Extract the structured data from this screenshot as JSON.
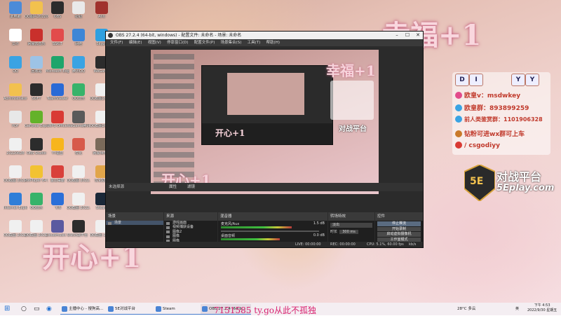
{
  "desktop": {
    "icons": [
      {
        "label": "此电脑",
        "color": "#4b8bd8"
      },
      {
        "label": "QQ图片20220...",
        "color": "#f2c14e"
      },
      {
        "label": "OBS",
        "color": "#2c2c2c"
      },
      {
        "label": "扭钮",
        "color": "#e9e9e9"
      },
      {
        "label": "Anti",
        "color": "#a0322d"
      },
      {
        "label": "文件",
        "color": "#ffffff"
      },
      {
        "label": "网易云音乐",
        "color": "#c9302c"
      },
      {
        "label": "SSKIT",
        "color": "#e24b4b"
      },
      {
        "label": "网络",
        "color": "#3e86d6"
      },
      {
        "label": "Skype",
        "color": "#2fa0e0"
      },
      {
        "label": "QQ",
        "color": "#3aa3e3"
      },
      {
        "label": "回收站",
        "color": "#9dc3e6"
      },
      {
        "label": "Microsoft Edge",
        "color": "#1fa56b"
      },
      {
        "label": "腾讯QQ",
        "color": "#3aa3e3"
      },
      {
        "label": "WeGame",
        "color": "#2c2c2c"
      },
      {
        "label": "Administrator",
        "color": "#f2c14e"
      },
      {
        "label": "SOFT",
        "color": "#2c2c2c"
      },
      {
        "label": "TeamViewer",
        "color": "#2a6ad6"
      },
      {
        "label": "QQ音乐",
        "color": "#37b36a"
      },
      {
        "label": "QQ截图2022...",
        "color": "#f0f0f0"
      },
      {
        "label": "PDF",
        "color": "#e8e8e8"
      },
      {
        "label": "GeForce Experience",
        "color": "#64b22a"
      },
      {
        "label": "WPS Office",
        "color": "#d93a34"
      },
      {
        "label": "WeGame腾讯",
        "color": "#5a5a5a"
      },
      {
        "label": "QQ截图2022...",
        "color": "#f0f0f0"
      },
      {
        "label": "20220626",
        "color": "#f0f0f0"
      },
      {
        "label": "OBS Studio",
        "color": "#2c2c2c"
      },
      {
        "label": "YY语音",
        "color": "#f7b51d"
      },
      {
        "label": "优化",
        "color": "#d75a4a"
      },
      {
        "label": "网易世界服",
        "color": "#7a6a5a"
      },
      {
        "label": "QQ截图 2022...",
        "color": "#f0f0f0"
      },
      {
        "label": "PotPlayer 64 bit",
        "color": "#f2c232"
      },
      {
        "label": "金山毒霸",
        "color": "#d9403a"
      },
      {
        "label": "QQ截图 2022...",
        "color": "#f0f0f0"
      },
      {
        "label": "优化助手",
        "color": "#e1a54a"
      },
      {
        "label": "Internet Explorer",
        "color": "#2f7ed8"
      },
      {
        "label": "QQ音乐",
        "color": "#37b36a"
      },
      {
        "label": "飞书",
        "color": "#2b6fd8"
      },
      {
        "label": "QQ截图 2022...",
        "color": "#f0f0f0"
      },
      {
        "label": "Steam",
        "color": "#1b2838"
      },
      {
        "label": "QQ截图 2022...",
        "color": "#f0f0f0"
      },
      {
        "label": "QQ截图 2022...",
        "color": "#f0f0f0"
      },
      {
        "label": "Cloudmusic Sampler",
        "color": "#5a5aa0"
      },
      {
        "label": "5E对战平台",
        "color": "#2c2c2c"
      },
      {
        "label": "QQ截图 2022...",
        "color": "#f0f0f0"
      }
    ],
    "overlay_top": "幸福+1",
    "overlay_bottom": "开心+1",
    "info_panel": {
      "diy": [
        "D",
        "I",
        "Y",
        "Y"
      ],
      "rows": [
        {
          "text": "欧皇v：msdwkey",
          "icon_color": "#e24b8b"
        },
        {
          "text": "欧皇群：893899259",
          "icon_color": "#3aa3e3"
        },
        {
          "text": "前人类鉴赏群：1101906328",
          "icon_color": "#3aa3e3"
        },
        {
          "text": "钻粉可进wx群可上车",
          "icon_color": "#c97a2a"
        },
        {
          "text": "/ csgodiyy",
          "icon_color": "#d93a34"
        }
      ]
    },
    "logo": {
      "main": "对战平台",
      "sub": "5Eplay.com",
      "mark": "5E"
    }
  },
  "obs": {
    "title": "OBS 27.2.4 (64-bit, windows) - 配置文件: 未命名 - 场景: 未命名",
    "menu": [
      "文件(F)",
      "编辑(E)",
      "视图(V)",
      "停靠窗口(D)",
      "配置文件(P)",
      "场景集合(S)",
      "工具(T)",
      "帮助(H)"
    ],
    "preview_texts": {
      "a": "幸福+1",
      "b": "开心+1",
      "c": "开心+1",
      "logo": "对战平台"
    },
    "tabs": {
      "nosource": "未选择源",
      "props": "属性",
      "filters": "滤镜"
    },
    "docks": {
      "scenes": {
        "title": "场景",
        "items": [
          "场景"
        ]
      },
      "sources": {
        "title": "来源",
        "items": [
          "游戏画面",
          "视频捕获设备",
          "图像2",
          "图像",
          "图像",
          "显示器采集"
        ]
      },
      "mixer": {
        "title": "混音器",
        "channels": [
          {
            "name": "麦克风/Aux",
            "db": "1.5 dB",
            "level": 0.72
          },
          {
            "name": "桌面音频",
            "db": "0.0 dB",
            "level": 0.6
          }
        ]
      },
      "transitions": {
        "title": "转场特效",
        "type": "淡出",
        "duration_label": "时长",
        "duration": "300 ms"
      },
      "controls": {
        "title": "控件",
        "buttons": [
          "停止推流",
          "开始录制",
          "启动虚拟摄像机",
          "工作室模式",
          "设置",
          "退出"
        ]
      }
    },
    "status": {
      "live": "LIVE: 00:00:00",
      "rec": "REC: 00:00:00",
      "cpu": "CPU: 5.1%, 60.00 fps",
      "kbps": "kb/s"
    }
  },
  "taskbar": {
    "apps": [
      "主播中心 - 搜狗高...",
      "5E对战平台",
      "Steam",
      "OBS 27.2.4 (64-b..."
    ],
    "marquee": "7151585 ty.go从此不孤独",
    "weather": "28°C 多云",
    "time": "下午 4:53",
    "date": "2022/9/30 星期五",
    "lang": "英"
  }
}
